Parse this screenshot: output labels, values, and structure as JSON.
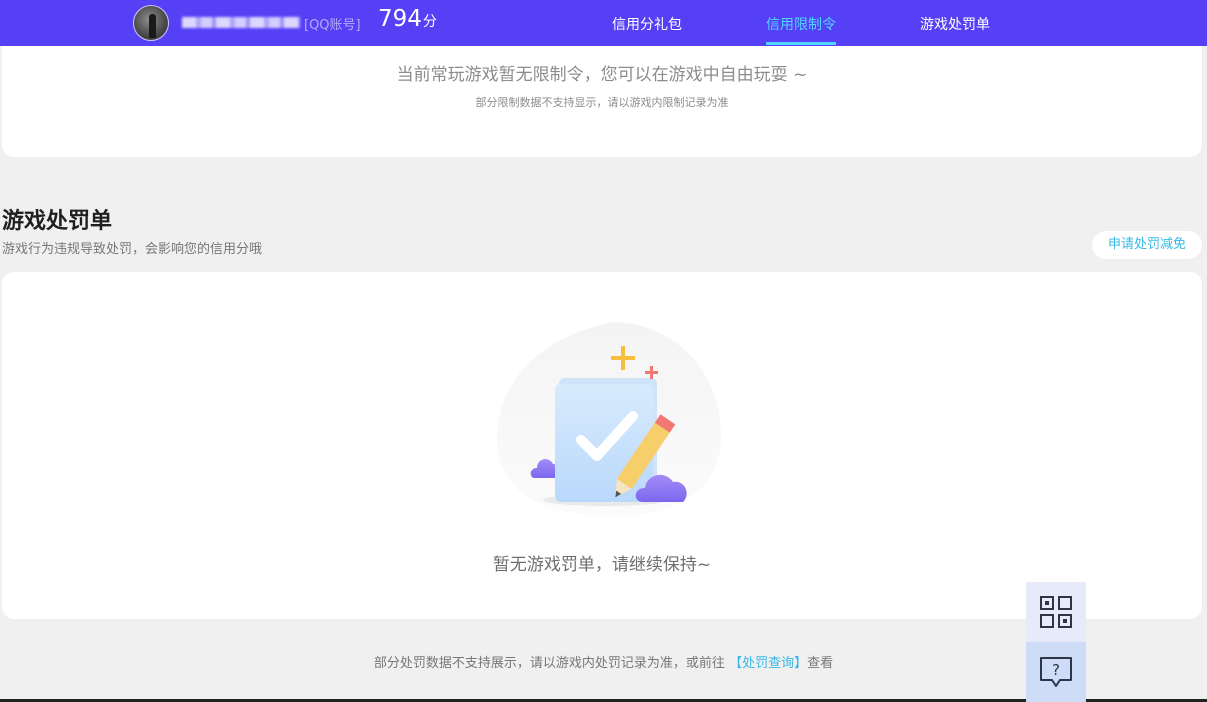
{
  "header": {
    "account_type": "[QQ账号]",
    "score": "794",
    "score_unit": "分",
    "nav": [
      {
        "label": "信用分礼包"
      },
      {
        "label": "信用限制令"
      },
      {
        "label": "游戏处罚单"
      }
    ],
    "active_index": 1
  },
  "restriction_card": {
    "message": "当前常玩游戏暂无限制令，您可以在游戏中自由玩耍 ~",
    "note": "部分限制数据不支持显示，请以游戏内限制记录为准"
  },
  "penalty_section": {
    "title": "游戏处罚单",
    "description": "游戏行为违规导致处罚，会影响您的信用分哦",
    "apply_button": "申请处罚减免",
    "empty_message": "暂无游戏罚单，请继续保持~"
  },
  "footer": {
    "note_prefix": "部分处罚数据不支持展示，请以游戏内处罚记录为准，或前往",
    "link_label": "【处罚查询】",
    "note_suffix": "查看"
  },
  "floating_tools": {
    "qr_icon": "qr-code-icon",
    "help_icon": "help-chat-icon"
  },
  "colors": {
    "header_bg": "#5640f6",
    "active_nav": "#4fd6ff",
    "link": "#35b9e6"
  }
}
